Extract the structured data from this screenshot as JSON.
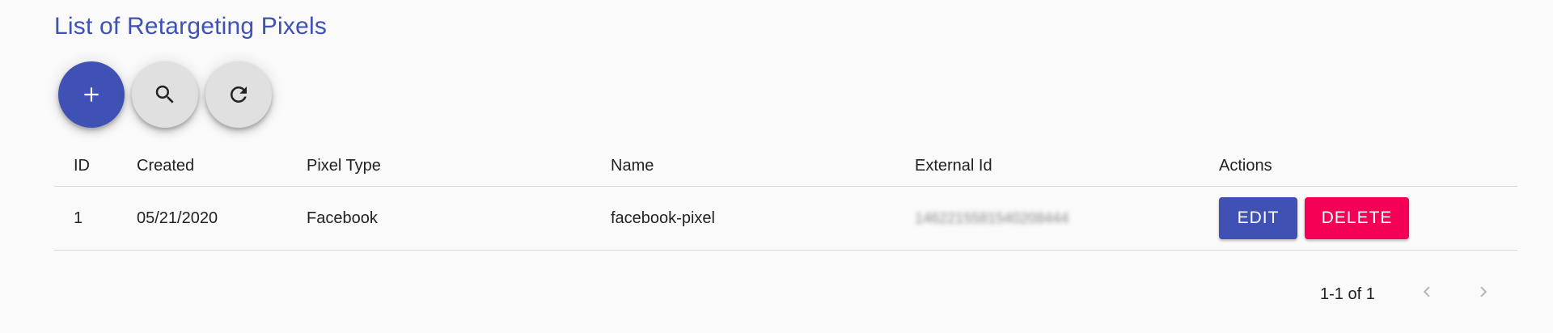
{
  "page": {
    "title": "List of Retargeting Pixels"
  },
  "toolbar": {
    "add_icon": "plus-icon",
    "search_icon": "search-icon",
    "refresh_icon": "refresh-icon",
    "accent_color": "#3f51b5"
  },
  "table": {
    "columns": [
      "ID",
      "Created",
      "Pixel Type",
      "Name",
      "External Id",
      "Actions"
    ],
    "rows": [
      {
        "id": "1",
        "created": "05/21/2020",
        "pixel_type": "Facebook",
        "name": "facebook-pixel",
        "external_id": "1462215581540208444",
        "edit_label": "EDIT",
        "delete_label": "DELETE"
      }
    ],
    "edit_color": "#3f51b5",
    "delete_color": "#f50057"
  },
  "pagination": {
    "range_text": "1-1 of 1",
    "prev_icon": "chevron-left-icon",
    "next_icon": "chevron-right-icon"
  }
}
